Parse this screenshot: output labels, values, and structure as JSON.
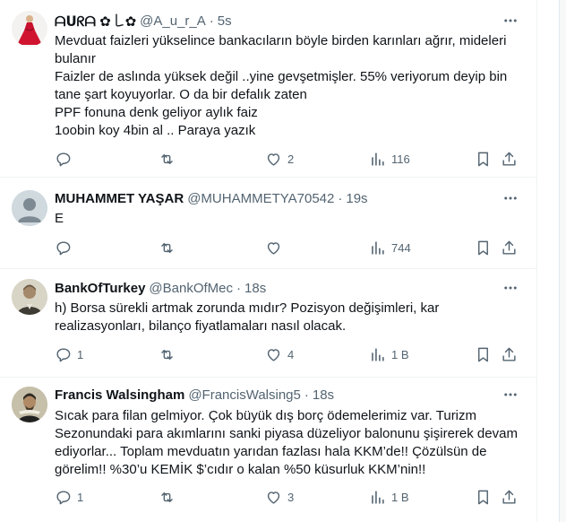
{
  "tweets": [
    {
      "name": "ᗩᑌᖇᗩ ✿ ꒒✿",
      "handle": "@A_u_r_A",
      "time": "5s",
      "lines": [
        "Mevduat faizleri yükselince bankacıların böyle birden karınları ağrır, mideleri bulanır",
        "Faizler de aslında yüksek değil ..yine gevşetmişler. 55% veriyorum deyip bin tane şart koyuyorlar. O da bir defalık zaten",
        "PPF fonuna denk geliyor aylık faiz",
        "1oobin koy 4bin al .. Paraya yazık"
      ],
      "replies": "",
      "retweets": "",
      "likes": "2",
      "views": "116"
    },
    {
      "name": "MUHAMMET YAŞAR",
      "handle": "@MUHAMMETYA70542",
      "time": "19s",
      "lines": [
        "E"
      ],
      "replies": "",
      "retweets": "",
      "likes": "",
      "views": "744"
    },
    {
      "name": "BankOfTurkey",
      "handle": "@BankOfMec",
      "time": "18s",
      "lines": [
        "h) Borsa sürekli artmak zorunda mıdır? Pozisyon değişimleri, kar realizasyonları, bilanço fiyatlamaları nasıl olacak."
      ],
      "replies": "1",
      "retweets": "",
      "likes": "4",
      "views": "1 B"
    },
    {
      "name": "Francis Walsingham",
      "handle": "@FrancisWalsing5",
      "time": "18s",
      "lines": [
        "Sıcak para filan gelmiyor. Çok büyük dış borç ödemelerimiz var. Turizm Sezonundaki para akımlarını sanki piyasa düzeliyor balonunu şişirerek devam ediyorlar... Toplam mevduatın yarıdan fazlası hala KKM’de!! Çözülsün de görelim!! %30’u KEMİK $’cıdır o kalan %50 küsurluk KKM’nin!!"
      ],
      "replies": "1",
      "retweets": "",
      "likes": "3",
      "views": "1 B"
    }
  ]
}
